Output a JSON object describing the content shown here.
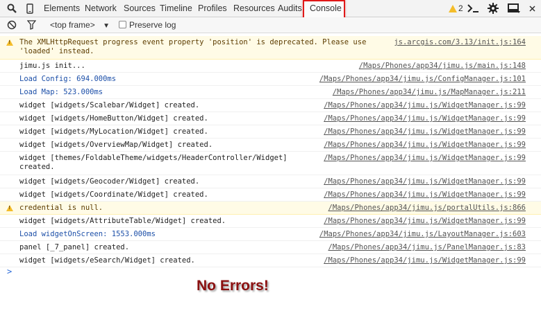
{
  "toolbar": {
    "tabs": [
      "Elements",
      "Network",
      "Sources",
      "Timeline",
      "Profiles",
      "Resources",
      "Audits"
    ],
    "active_tab": "Console",
    "warning_count": "2"
  },
  "filterbar": {
    "frame_select": "<top frame>",
    "preserve_log_label": "Preserve log"
  },
  "messages": [
    {
      "level": "warn",
      "text": "The XMLHttpRequest progress event property 'position' is deprecated. Please use\n'loaded' instead.",
      "source": "js.arcgis.com/3.13/init.js:164"
    },
    {
      "level": "log",
      "text": "jimu.js init...",
      "source": "/Maps/Phones/app34/jimu.js/main.js:148"
    },
    {
      "level": "info",
      "text": "Load Config: 694.000ms",
      "source": "/Maps/Phones/app34/jimu.js/ConfigManager.js:101"
    },
    {
      "level": "info",
      "text": "Load Map: 523.000ms",
      "source": "/Maps/Phones/app34/jimu.js/MapManager.js:211"
    },
    {
      "level": "log",
      "text": "widget [widgets/Scalebar/Widget] created.",
      "source": "/Maps/Phones/app34/jimu.js/WidgetManager.js:99"
    },
    {
      "level": "log",
      "text": "widget [widgets/HomeButton/Widget] created.",
      "source": "/Maps/Phones/app34/jimu.js/WidgetManager.js:99"
    },
    {
      "level": "log",
      "text": "widget [widgets/MyLocation/Widget] created.",
      "source": "/Maps/Phones/app34/jimu.js/WidgetManager.js:99"
    },
    {
      "level": "log",
      "text": "widget [widgets/OverviewMap/Widget] created.",
      "source": "/Maps/Phones/app34/jimu.js/WidgetManager.js:99"
    },
    {
      "level": "log",
      "text": "widget [themes/FoldableTheme/widgets/HeaderController/Widget]\ncreated.",
      "source": "/Maps/Phones/app34/jimu.js/WidgetManager.js:99"
    },
    {
      "level": "log",
      "text": "widget [widgets/Geocoder/Widget] created.",
      "source": "/Maps/Phones/app34/jimu.js/WidgetManager.js:99"
    },
    {
      "level": "log",
      "text": "widget [widgets/Coordinate/Widget] created.",
      "source": "/Maps/Phones/app34/jimu.js/WidgetManager.js:99"
    },
    {
      "level": "warn",
      "text": "credential is null.",
      "source": "/Maps/Phones/app34/jimu.js/portalUtils.js:866"
    },
    {
      "level": "log",
      "text": "widget [widgets/AttributeTable/Widget] created.",
      "source": "/Maps/Phones/app34/jimu.js/WidgetManager.js:99"
    },
    {
      "level": "info",
      "text": "Load widgetOnScreen: 1553.000ms",
      "source": "/Maps/Phones/app34/jimu.js/LayoutManager.js:603"
    },
    {
      "level": "log",
      "text": "panel [_7_panel] created.",
      "source": "/Maps/Phones/app34/jimu.js/PanelManager.js:83"
    },
    {
      "level": "log",
      "text": "widget [widgets/eSearch/Widget] created.",
      "source": "/Maps/Phones/app34/jimu.js/WidgetManager.js:99"
    }
  ],
  "prompt_symbol": ">",
  "annotation": "No Errors!"
}
